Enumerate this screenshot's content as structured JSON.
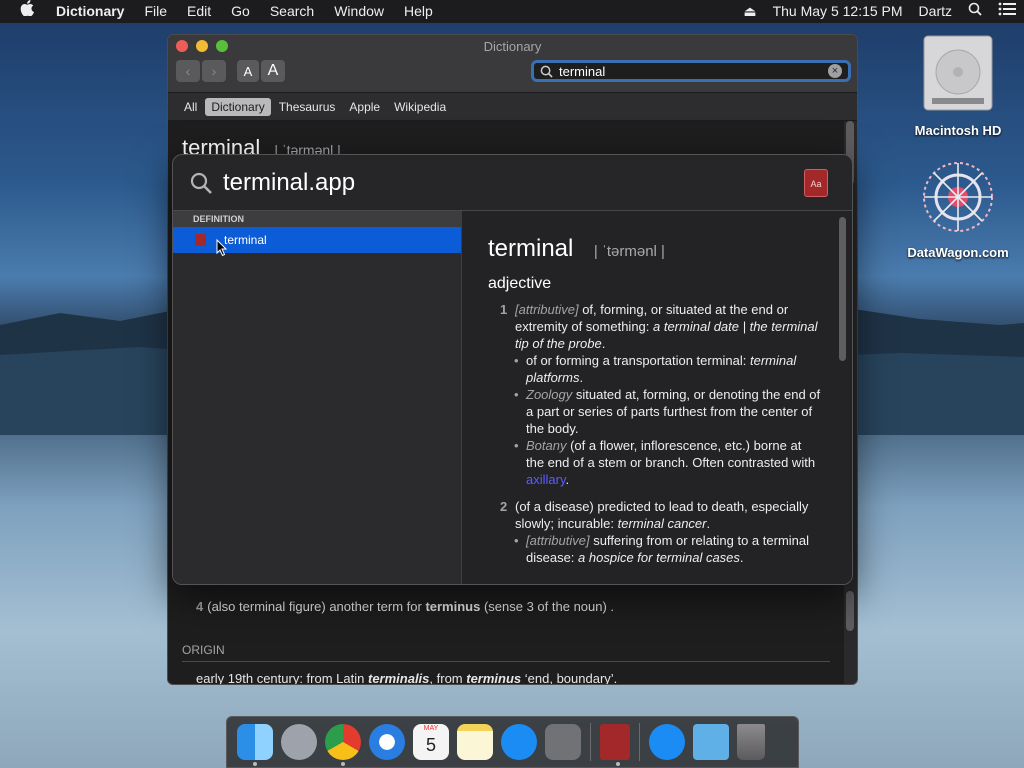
{
  "menubar": {
    "app": "Dictionary",
    "items": [
      "File",
      "Edit",
      "Go",
      "Search",
      "Window",
      "Help"
    ],
    "clock": "Thu May 5  12:15 PM",
    "user": "Dartz"
  },
  "desktop": {
    "icons": [
      {
        "label": "Macintosh HD"
      },
      {
        "label": "DataWagon.com"
      }
    ]
  },
  "window": {
    "title": "Dictionary",
    "search_value": "terminal",
    "font_small": "A",
    "font_large": "A",
    "tabs": [
      "All",
      "Dictionary",
      "Thesaurus",
      "Apple",
      "Wikipedia"
    ],
    "selected_tab": "Dictionary",
    "headword": "terminal",
    "pron": "| ˈtərmənl |",
    "def4_num": "4",
    "def4_text": "(also terminal figure) another term for ",
    "def4_link": "terminus",
    "def4_rest": " (sense 3 of the noun) .",
    "origin_label": "ORIGIN",
    "origin_a": "early 19th century: from Latin ",
    "origin_b": "terminalis",
    "origin_c": ", from ",
    "origin_d": "terminus",
    "origin_e": " ‘end, boundary’."
  },
  "spotlight": {
    "query": "terminal.app",
    "section": "DEFINITION",
    "result": "terminal",
    "headword": "terminal",
    "pron": "| ˈtərmənl |",
    "pos": "adjective",
    "d1": {
      "num": "1",
      "label": "[attributive]",
      "text": " of, forming, or situated at the end or extremity of something: ",
      "ex": "a terminal date | the terminal tip of the probe",
      "end": "."
    },
    "s1": {
      "text": "of or forming a transportation terminal: ",
      "ex": "terminal platforms",
      "end": "."
    },
    "s2": {
      "label": "Zoology",
      "text": " situated at, forming, or denoting the end of a part or series of parts furthest from the center of the body."
    },
    "s3": {
      "label": "Botany",
      "text": " (of a flower, inflorescence, etc.) borne at the end of a stem or branch. Often contrasted with ",
      "link": "axillary",
      "end": "."
    },
    "d2": {
      "num": "2",
      "text": "(of a disease) predicted to lead to death, especially slowly; incurable: ",
      "ex": "terminal cancer",
      "end": "."
    },
    "s4": {
      "label": "[attributive]",
      "text": " suffering from or relating to a terminal disease: ",
      "ex": "a hospice for terminal cases",
      "end": "."
    }
  },
  "dock": {
    "apps": [
      "finder-icon",
      "launchpad-icon",
      "chrome-icon",
      "safari-icon",
      "calendar-icon",
      "notes-icon",
      "app-store-icon",
      "system-preferences-icon",
      "dictionary-icon",
      "app-store-download-icon",
      "downloads-folder-icon",
      "trash-icon"
    ],
    "calendar_month": "MAY",
    "calendar_day": "5"
  },
  "colors": {
    "accent": "#0b5cd6",
    "link": "#5c5cff"
  }
}
